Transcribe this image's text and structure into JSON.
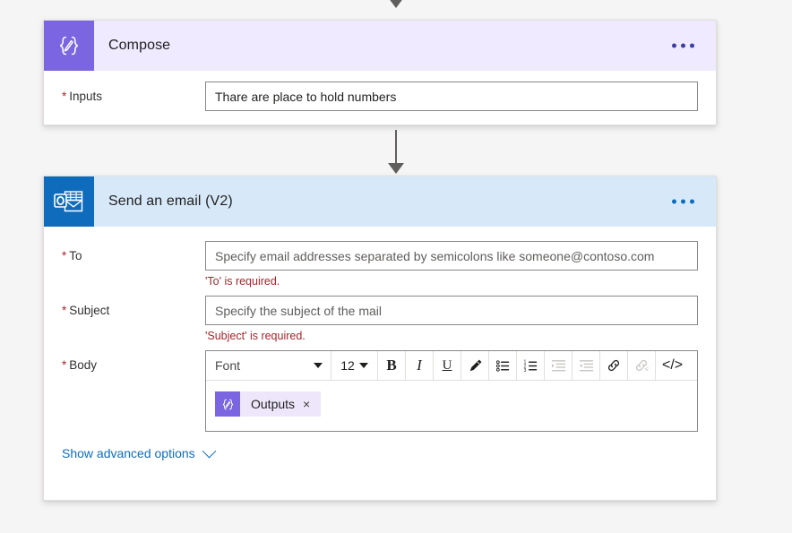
{
  "flow": {
    "connector_top_icon": "arrow-down-icon",
    "connector_mid_icon": "arrow-down-icon"
  },
  "compose_card": {
    "icon": "compose-braces-icon",
    "title": "Compose",
    "menu_icon": "ellipsis-icon",
    "inputs": {
      "label": "Inputs",
      "required_marker": "*",
      "value": "Thare are place to hold numbers",
      "placeholder": ""
    }
  },
  "email_card": {
    "icon": "outlook-icon",
    "title": "Send an email (V2)",
    "menu_icon": "ellipsis-icon",
    "to": {
      "label": "To",
      "required_marker": "*",
      "value": "",
      "placeholder": "Specify email addresses separated by semicolons like someone@contoso.com",
      "error": "'To' is required."
    },
    "subject": {
      "label": "Subject",
      "required_marker": "*",
      "value": "",
      "placeholder": "Specify the subject of the mail",
      "error": "'Subject' is required."
    },
    "body": {
      "label": "Body",
      "required_marker": "*",
      "toolbar": {
        "font_label": "Font",
        "font_caret_icon": "caret-down-icon",
        "size_label": "12",
        "size_caret_icon": "caret-down-icon",
        "bold_label": "B",
        "bold_icon": "bold-icon",
        "italic_label": "I",
        "italic_icon": "italic-icon",
        "underline_label": "U",
        "underline_icon": "underline-icon",
        "highlight_icon": "highlighter-pen-icon",
        "bullet_list_icon": "bulleted-list-icon",
        "numbered_list_icon": "numbered-list-icon",
        "indent_increase_icon": "indent-increase-icon",
        "indent_decrease_icon": "indent-decrease-icon",
        "link_icon": "link-icon",
        "unlink_icon": "unlink-icon",
        "code_label": "</>",
        "code_icon": "code-view-icon"
      },
      "token": {
        "icon": "compose-braces-icon",
        "label": "Outputs",
        "remove_label": "×",
        "remove_icon": "close-icon"
      }
    },
    "advanced_options": {
      "label": "Show advanced options",
      "chevron_icon": "chevron-down-icon"
    }
  },
  "colors": {
    "canvas": "#f5f5f5",
    "compose_header": "#efeaff",
    "compose_accent": "#7b65e0",
    "email_header": "#d7e9f9",
    "email_accent": "#0f6cbd",
    "error_text": "#a4262c",
    "link": "#0f6cbd"
  }
}
